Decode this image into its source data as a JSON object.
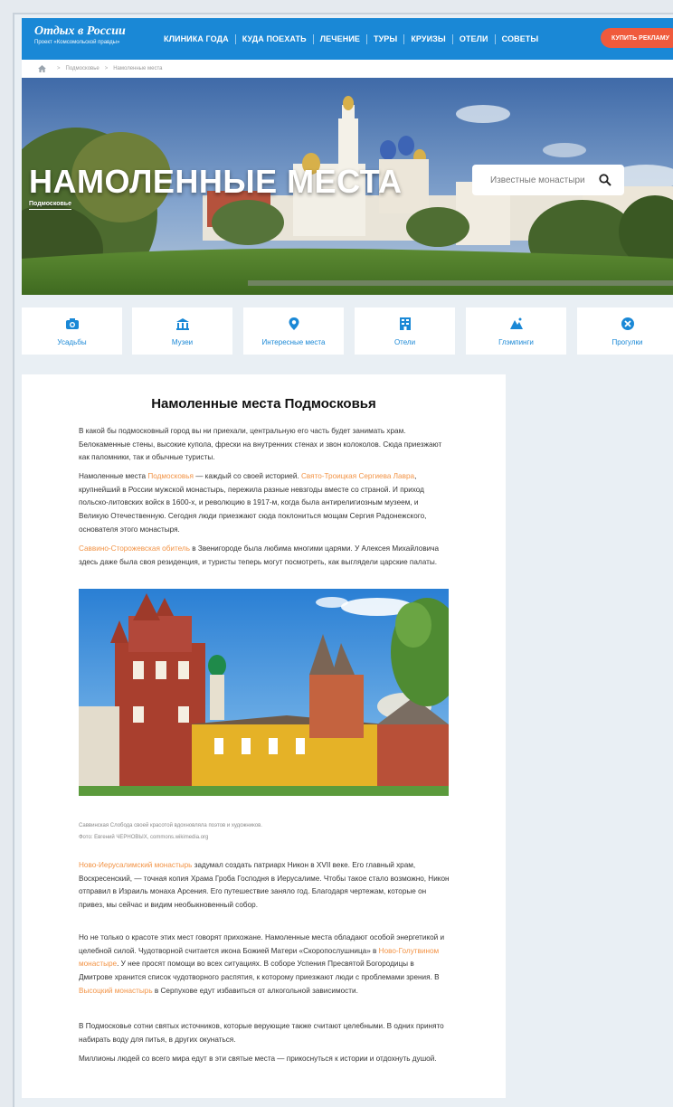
{
  "header": {
    "logo_title": "Отдых в России",
    "logo_subtitle": "Проект «Комсомольской правды»",
    "nav": [
      "КЛИНИКА ГОДА",
      "КУДА ПОЕХАТЬ",
      "ЛЕЧЕНИЕ",
      "ТУРЫ",
      "КРУИЗЫ",
      "ОТЕЛИ",
      "СОВЕТЫ"
    ],
    "ad_button": "КУПИТЬ РЕКЛАМУ",
    "accent_color": "#1a88d6",
    "ad_color": "#f05a3c"
  },
  "breadcrumb": {
    "items": [
      "Подмосковье",
      "Намоленные места"
    ]
  },
  "hero": {
    "title": "НАМОЛЕННЫЕ МЕСТА",
    "subtitle": "Подмосковье",
    "search_placeholder": "Известные монастыри"
  },
  "categories": [
    {
      "label": "Усадьбы",
      "icon": "camera-icon"
    },
    {
      "label": "Музеи",
      "icon": "museum-icon"
    },
    {
      "label": "Интересные места",
      "icon": "map-pin-icon"
    },
    {
      "label": "Отели",
      "icon": "hotel-icon"
    },
    {
      "label": "Глэмпинги",
      "icon": "tent-icon"
    },
    {
      "label": "Прогулки",
      "icon": "walk-icon"
    }
  ],
  "article": {
    "title": "Намоленные места Подмосковья",
    "p1": "В какой бы подмосковный город вы ни приехали, центральную его часть будет занимать храм. Белокаменные стены, высокие купола, фрески на внутренних стенах и звон колоколов. Сюда приезжают как паломники, так и обычные туристы.",
    "p2_a": "Намоленные места ",
    "p2_link1": "Подмосковья",
    "p2_b": " — каждый со своей историей. ",
    "p2_link2": "Свято-Троицкая Сергиева Лавра",
    "p2_c": ", крупнейший в России мужской монастырь, пережила разные невзгоды вместе со страной. И приход польско-литовских войск в 1600-х, и революцию в 1917-м, когда была антирелигиозным музеем, и Великую Отечественную. Сегодня люди приезжают сюда поклониться мощам Сергия Радонежского, основателя этого монастыря.",
    "p3_link": "Саввино-Сторожевская обитель",
    "p3_text": " в Звенигороде была любима многими царями. У Алексея Михайловича здесь даже была своя резиденция, и туристы теперь могут посмотреть, как выглядели царские палаты.",
    "caption": "Саввинская Слобода своей красотой вдохновляла поэтов и художников.",
    "photo_credit": "Фото: Евгений ЧЕРНОВЫХ, commons.wikimedia.org",
    "p4_link": "Ново-Иерусалимский монастырь",
    "p4_text": " задумал создать патриарх Никон в XVII веке. Его главный храм, Воскресенский, — точная копия Храма Гроба Господня в Иерусалиме. Чтобы такое стало возможно, Никон отправил в Израиль монаха Арсения. Его путешествие заняло год. Благодаря чертежам, которые он привез, мы сейчас и видим необыкновенный собор.",
    "p5_a": "Но не только о красоте этих мест говорят прихожане. Намоленные места обладают особой энергетикой и целебной силой. Чудотворной считается икона Божией Матери «Скоропослушница» в ",
    "p5_link1": "Ново-Голутвином монастыре",
    "p5_b": ". У нее просят помощи во всех ситуациях. В соборе Успения Пресвятой Богородицы в Дмитрове хранится список чудотворного распятия, к которому приезжают люди с проблемами зрения. В ",
    "p5_link2": "Высоцкий монастырь",
    "p5_c": " в Серпухове едут избавиться от алкогольной зависимости.",
    "p6": "В Подмосковье сотни святых источников, которые верующие также считают целебными. В одних принято набирать воду для питья, в других окунаться.",
    "p7": "Миллионы людей со всего мира едут в эти святые места — прикоснуться к истории и отдохнуть душой.",
    "link_color": "#f29345"
  }
}
